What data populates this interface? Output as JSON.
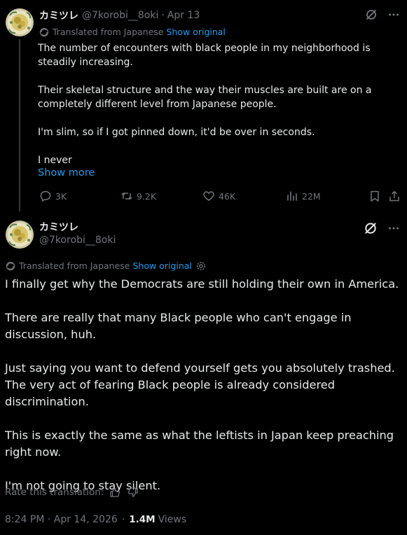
{
  "parent_tweet": {
    "display_name": "カミツレ",
    "handle": "@7korobi__8oki",
    "separator": "·",
    "date": "Apr 13",
    "translation_note": "Translated from Japanese",
    "show_original": "Show original",
    "body": "The number of encounters with black people in my neighborhood is steadily increasing.\n\nTheir skeletal structure and the way their muscles are built are on a completely different level from Japanese people.\n\nI'm slim, so if I got pinned down, it'd be over in seconds.\n\nI never",
    "show_more": "Show more",
    "replies": "3K",
    "reposts": "9.2K",
    "likes": "46K",
    "views": "22M"
  },
  "main_tweet": {
    "display_name": "カミツレ",
    "handle": "@7korobi__8oki",
    "translation_note": "Translated from Japanese",
    "show_original": "Show original",
    "body": "I finally get why the Democrats are still holding their own in America.\n\nThere are really that many Black people who can't engage in discussion, huh.\n\nJust saying you want to defend yourself gets you absolutely trashed.\nThe very act of fearing Black people is already considered discrimination.\n\nThis is exactly the same as what the leftists in Japan keep preaching right now.\n\nI'm not going to stay silent.",
    "rate_label": "Rate this translation:",
    "timestamp": "8:24 PM · Apr 14, 2026",
    "separator": "·",
    "views_count": "1.4M",
    "views_label": "Views"
  },
  "colors": {
    "background": "#000000",
    "text": "#e7e9ea",
    "muted": "#71767b",
    "link": "#1d9bf0"
  },
  "icons": {
    "grok": "slashed-circle-icon",
    "more": "more-dots-icon",
    "translate": "translate-icon",
    "settings": "gear-icon"
  }
}
